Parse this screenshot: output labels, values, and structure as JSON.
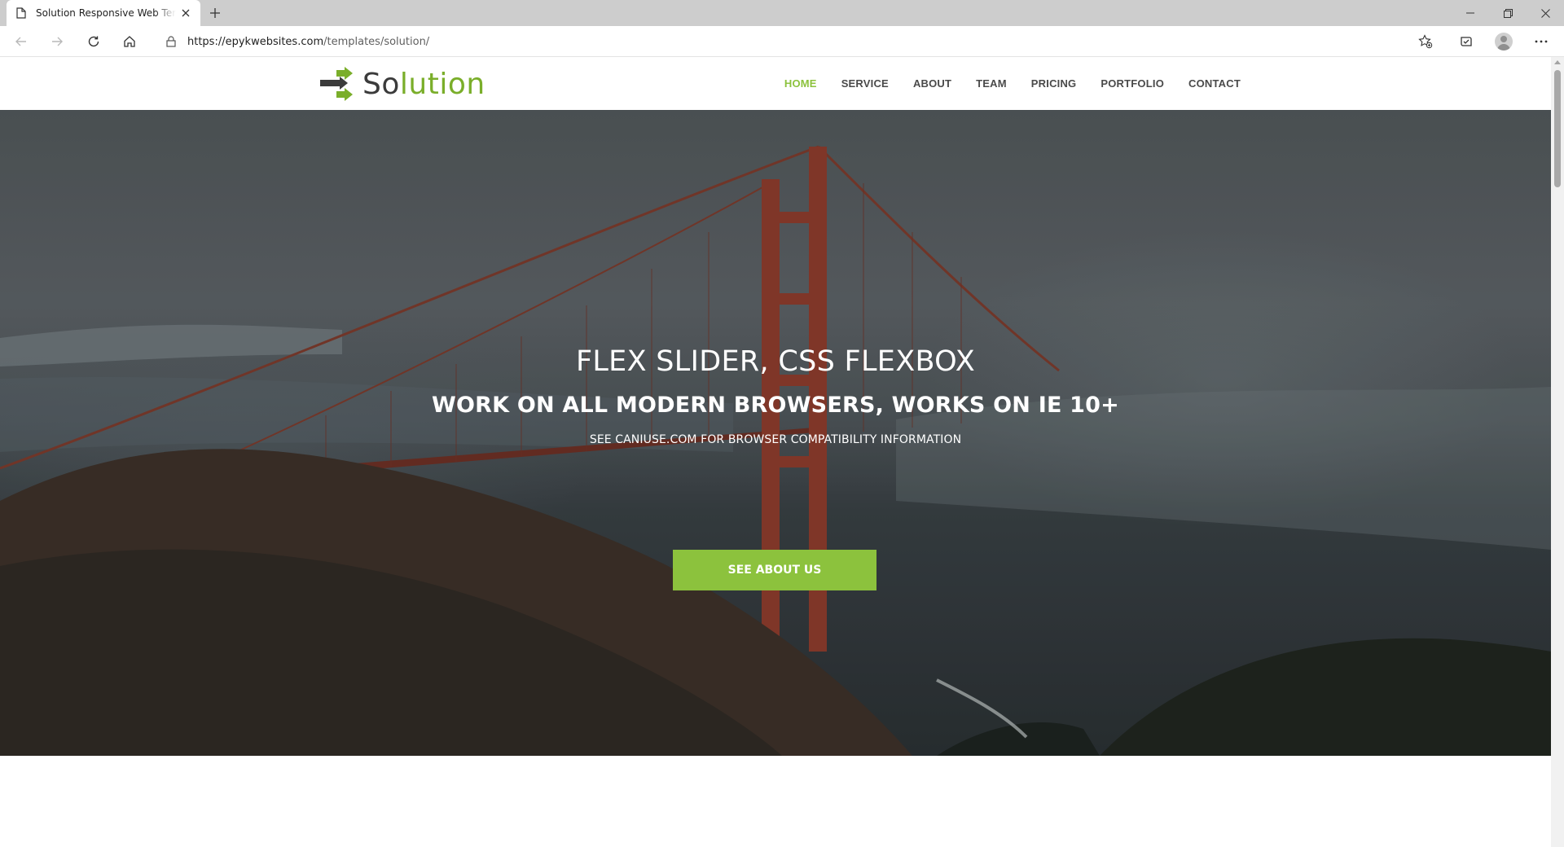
{
  "browser": {
    "tab_title": "Solution Responsive Web Template",
    "url_host": "https://epykwebsites.com",
    "url_path": "/templates/solution/"
  },
  "site": {
    "logo_text_main": "So",
    "logo_text_accent": "lution",
    "nav": [
      {
        "label": "HOME",
        "active": true
      },
      {
        "label": "SERVICE"
      },
      {
        "label": "ABOUT"
      },
      {
        "label": "TEAM"
      },
      {
        "label": "PRICING"
      },
      {
        "label": "PORTFOLIO"
      },
      {
        "label": "CONTACT"
      }
    ]
  },
  "hero": {
    "title": "FLEX SLIDER, CSS FLEXBOX",
    "subtitle": "WORK ON ALL MODERN BROWSERS, WORKS ON IE 10+",
    "note": "SEE CANIUSE.COM FOR BROWSER COMPATIBILITY INFORMATION",
    "button_label": "SEE ABOUT US"
  },
  "colors": {
    "accent_green": "#8cc23d",
    "logo_green": "#7aae2a",
    "bridge_red": "#8a3b2c"
  },
  "icons": [
    "page-icon",
    "close-icon",
    "plus-icon",
    "minimize-icon",
    "restore-icon",
    "back-arrow-icon",
    "forward-arrow-icon",
    "reload-icon",
    "home-icon",
    "lock-icon",
    "add-favorite-icon",
    "collections-icon",
    "profile-icon",
    "more-icon"
  ]
}
